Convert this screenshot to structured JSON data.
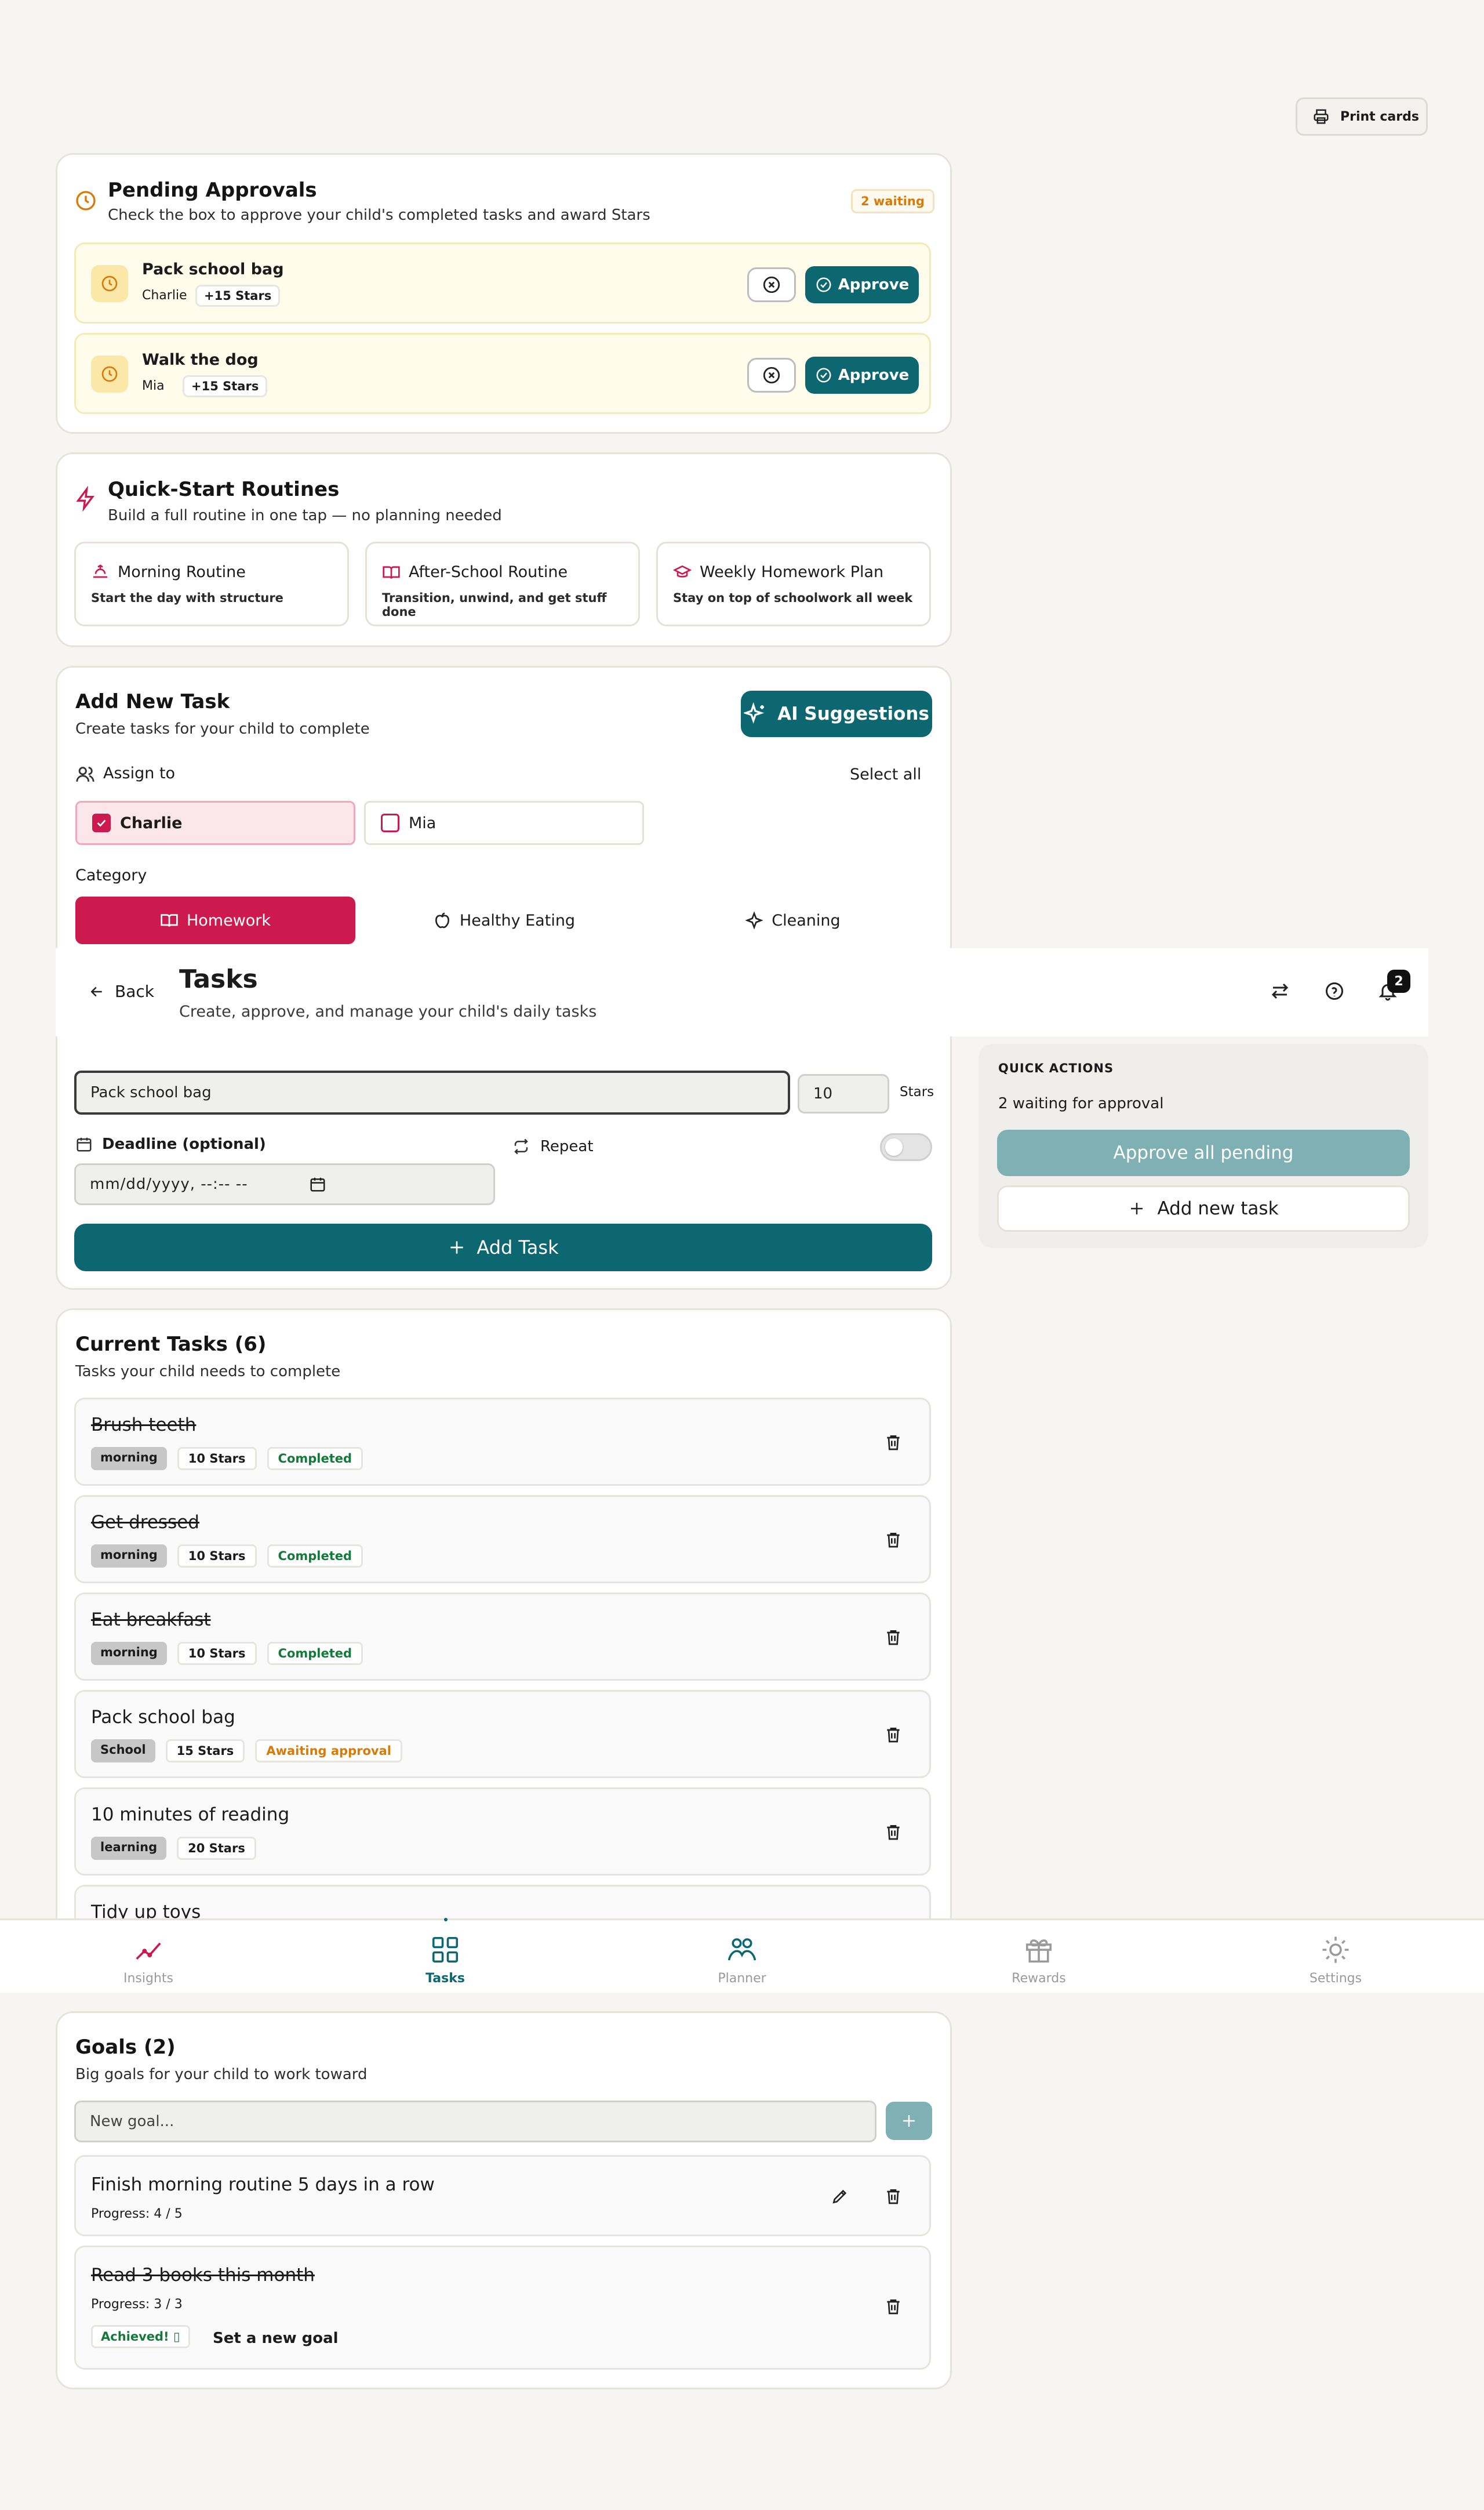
{
  "print_cards": "Print cards",
  "pending": {
    "title": "Pending Approvals",
    "subtitle": "Check the box to approve your child's completed tasks and award Stars",
    "badge": "2 waiting",
    "approve_label": "Approve",
    "items": [
      {
        "task": "Pack school bag",
        "child": "Charlie",
        "stars": "+15 Stars"
      },
      {
        "task": "Walk the dog",
        "child": "Mia",
        "stars": "+15 Stars"
      }
    ]
  },
  "routines": {
    "title": "Quick-Start Routines",
    "subtitle": "Build a full routine in one tap — no planning needed",
    "items": [
      {
        "title": "Morning Routine",
        "desc": "Start the day with structure",
        "icon": "sunrise-icon"
      },
      {
        "title": "After-School Routine",
        "desc": "Transition, unwind, and get stuff done",
        "icon": "book-icon"
      },
      {
        "title": "Weekly Homework Plan",
        "desc": "Stay on top of schoolwork all week",
        "icon": "graduation-cap-icon"
      }
    ]
  },
  "add_task": {
    "title": "Add New Task",
    "subtitle": "Create tasks for your child to complete",
    "ai_button": "AI Suggestions",
    "assign_label": "Assign to",
    "select_all": "Select all",
    "children": [
      {
        "name": "Charlie",
        "checked": true
      },
      {
        "name": "Mia",
        "checked": false
      }
    ],
    "category_label": "Category",
    "categories": [
      {
        "name": "Homework",
        "selected": true
      },
      {
        "name": "Healthy Eating",
        "selected": false
      },
      {
        "name": "Cleaning",
        "selected": false
      }
    ],
    "task_value": "Pack school bag",
    "stars_value": "10",
    "stars_label": "Stars",
    "deadline_label": "Deadline (optional)",
    "deadline_placeholder": "mm/dd/yyyy, --:-- --",
    "repeat_label": "Repeat",
    "repeat_on": false,
    "submit": "Add Task"
  },
  "header": {
    "back": "Back",
    "title": "Tasks",
    "subtitle": "Create, approve, and manage your child's daily tasks",
    "notifications": "2"
  },
  "quick_actions": {
    "title": "QUICK ACTIONS",
    "status": "2 waiting for approval",
    "approve_all": "Approve all pending",
    "add_new": "Add new task"
  },
  "current_tasks": {
    "title": "Current Tasks (6)",
    "subtitle": "Tasks your child needs to complete",
    "items": [
      {
        "name": "Brush teeth",
        "category": "morning",
        "stars": "10 Stars",
        "status": "Completed",
        "done": true
      },
      {
        "name": "Get dressed",
        "category": "morning",
        "stars": "10 Stars",
        "status": "Completed",
        "done": true
      },
      {
        "name": "Eat breakfast",
        "category": "morning",
        "stars": "10 Stars",
        "status": "Completed",
        "done": true
      },
      {
        "name": "Pack school bag",
        "category": "School",
        "stars": "15 Stars",
        "status": "Awaiting approval",
        "done": false
      },
      {
        "name": "10 minutes of reading",
        "category": "learning",
        "stars": "20 Stars",
        "status": "",
        "done": false
      },
      {
        "name": "Tidy up toys",
        "category": "",
        "stars": "",
        "status": "",
        "done": false
      }
    ]
  },
  "nav": {
    "items": [
      {
        "label": "Insights",
        "active": false
      },
      {
        "label": "Tasks",
        "active": true
      },
      {
        "label": "Planner",
        "active": false
      },
      {
        "label": "Rewards",
        "active": false
      },
      {
        "label": "Settings",
        "active": false
      }
    ]
  },
  "goals": {
    "title": "Goals (2)",
    "subtitle": "Big goals for your child to work toward",
    "input_placeholder": "New goal...",
    "items": [
      {
        "name": "Finish morning routine 5 days in a row",
        "progress": "Progress: 4 / 5",
        "done": false
      },
      {
        "name": "Read 3 books this month",
        "progress": "Progress: 3 / 3",
        "done": true,
        "achieved": "Achieved! ▯",
        "new_goal": "Set a new goal"
      }
    ]
  },
  "colors": {
    "teal": "#0c6770",
    "crimson": "#cc1a4e",
    "amber": "#d97a06",
    "green": "#147a3a"
  }
}
